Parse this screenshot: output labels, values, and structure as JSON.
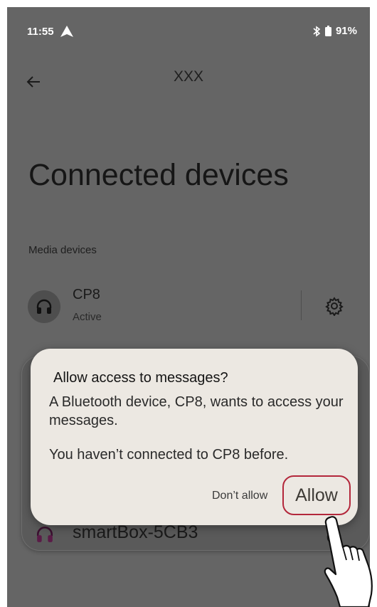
{
  "status_bar": {
    "time": "11:55",
    "battery": "91%",
    "icons": [
      "navigation-icon",
      "bluetooth-icon",
      "battery-icon"
    ]
  },
  "top_bar": {
    "back_icon": "arrow-left-icon",
    "title": "XXX"
  },
  "page": {
    "title": "Connected devices",
    "section_header": "Media devices"
  },
  "devices": [
    {
      "name": "CP8",
      "status": "Active",
      "icon": "headphones-icon",
      "action_icon": "gear-icon"
    }
  ],
  "background_device": {
    "name": "smartBox-5CB3",
    "icon": "headphones-icon",
    "action_icon": "gear-icon"
  },
  "dialog": {
    "title": "Allow access to messages?",
    "body_line1": "A Bluetooth device, CP8, wants to access your messages.",
    "body_line2": "You haven’t connected to CP8 before.",
    "deny_label": "Don’t allow",
    "allow_label": "Allow"
  },
  "colors": {
    "scrim": "#656565",
    "dialog_bg": "#ece8e2",
    "highlight": "#b3273b"
  }
}
